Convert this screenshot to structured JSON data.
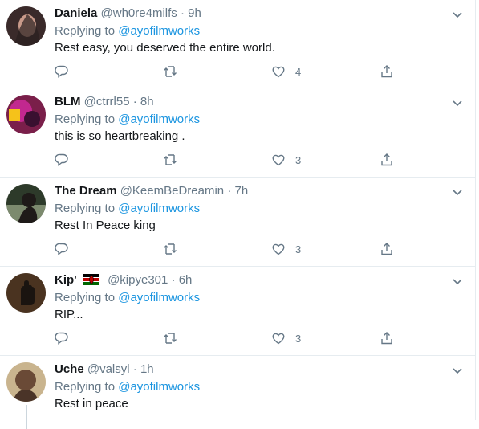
{
  "replies": [
    {
      "name": "Daniela",
      "handle": "@wh0re4milfs",
      "dot": "·",
      "time": "9h",
      "replying_prefix": "Replying to",
      "replying_to": "@ayofilmworks",
      "text": "Rest easy, you deserved the entire world.",
      "like_count": "4",
      "avatar_colors": [
        "#3a2a2a",
        "#c99a8a"
      ]
    },
    {
      "name": "BLM",
      "handle": "@ctrrl55",
      "dot": "·",
      "time": "8h",
      "replying_prefix": "Replying to",
      "replying_to": "@ayofilmworks",
      "text": "this is so heartbreaking .",
      "like_count": "3",
      "avatar_colors": [
        "#7a1f4a",
        "#d42aa0"
      ]
    },
    {
      "name": "The Dream",
      "handle": "@KeemBeDreamin",
      "dot": "·",
      "time": "7h",
      "replying_prefix": "Replying to",
      "replying_to": "@ayofilmworks",
      "text": "Rest In Peace king",
      "like_count": "3",
      "avatar_colors": [
        "#2d3a2a",
        "#7c8a6e"
      ]
    },
    {
      "name": "Kip'",
      "handle": "@kipye301",
      "dot": "·",
      "time": "6h",
      "replying_prefix": "Replying to",
      "replying_to": "@ayofilmworks",
      "text": "RIP...",
      "like_count": "3",
      "avatar_colors": [
        "#4a3320",
        "#1a1410"
      ]
    },
    {
      "name": "Uche",
      "handle": "@valsyl",
      "dot": "·",
      "time": "1h",
      "replying_prefix": "Replying to",
      "replying_to": "@ayofilmworks",
      "text": "Rest in peace",
      "like_count": "",
      "avatar_colors": [
        "#c9b48e",
        "#6a4a36"
      ]
    }
  ],
  "icons": {
    "reply": "reply-icon",
    "retweet": "retweet-icon",
    "like": "heart-icon",
    "share": "share-icon",
    "more": "chevron-down-icon"
  },
  "colors": {
    "link": "#1b95e0",
    "muted": "#657786",
    "text": "#14171a"
  }
}
